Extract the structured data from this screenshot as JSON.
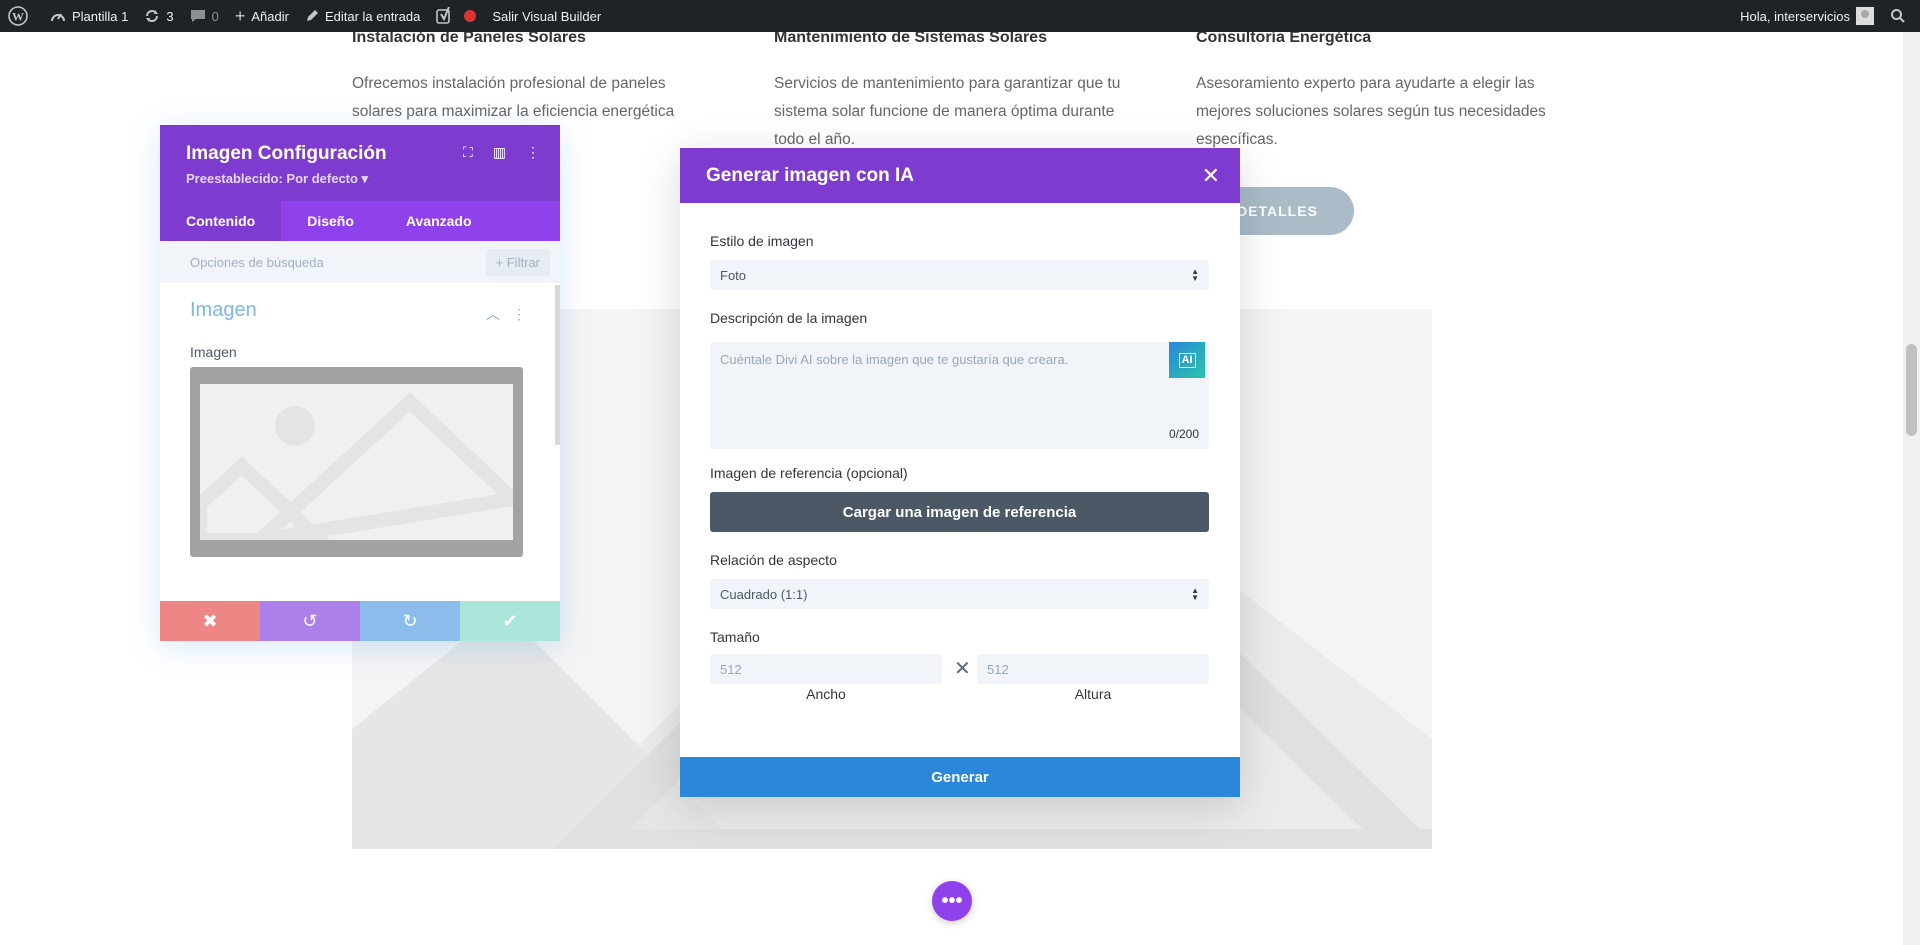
{
  "admin_bar": {
    "site_name": "Plantilla 1",
    "updates_count": "3",
    "comments_count": "0",
    "add_new": "Añadir",
    "edit_entry": "Editar la entrada",
    "exit_builder": "Salir Visual Builder",
    "greeting": "Hola, interservicios"
  },
  "services": [
    {
      "title": "Instalación de Paneles Solares",
      "text": "Ofrecemos instalación profesional de paneles solares para maximizar la eficiencia energética"
    },
    {
      "title": "Mantenimiento de Sistemas Solares",
      "text": "Servicios de mantenimiento para garantizar que tu sistema solar funcione de manera óptima durante todo el año."
    },
    {
      "title": "Consultoría Energética",
      "text": "Asesoramiento experto para ayudarte a elegir las mejores soluciones solares según tus necesidades específicas."
    }
  ],
  "details_button": "R DETALLES",
  "settings_panel": {
    "title": "Imagen Configuración",
    "preset": "Preestablecido: Por defecto ▾",
    "tabs": [
      "Contenido",
      "Diseño",
      "Avanzado"
    ],
    "search_placeholder": "Opciones de búsqueda",
    "filter": "+ Filtrar",
    "section_title": "Imagen",
    "field_label": "Imagen"
  },
  "modal": {
    "title": "Generar imagen con IA",
    "style_label": "Estilo de imagen",
    "style_value": "Foto",
    "description_label": "Descripción de la imagen",
    "description_placeholder": "Cuéntale Divi AI sobre la imagen que te gustaría que creara.",
    "char_count": "0/200",
    "ai_badge": "AI",
    "reference_label": "Imagen de referencia (opcional)",
    "upload_button": "Cargar una imagen de referencia",
    "aspect_label": "Relación de aspecto",
    "aspect_value": "Cuadrado (1:1)",
    "size_label": "Tamaño",
    "width_value": "512",
    "height_value": "512",
    "width_label": "Ancho",
    "height_label": "Altura",
    "generate_button": "Generar"
  },
  "colors": {
    "purple_dark": "#7e3bd0",
    "purple": "#8f42ec",
    "blue": "#2b87da",
    "admin_bar": "#1d2327"
  }
}
